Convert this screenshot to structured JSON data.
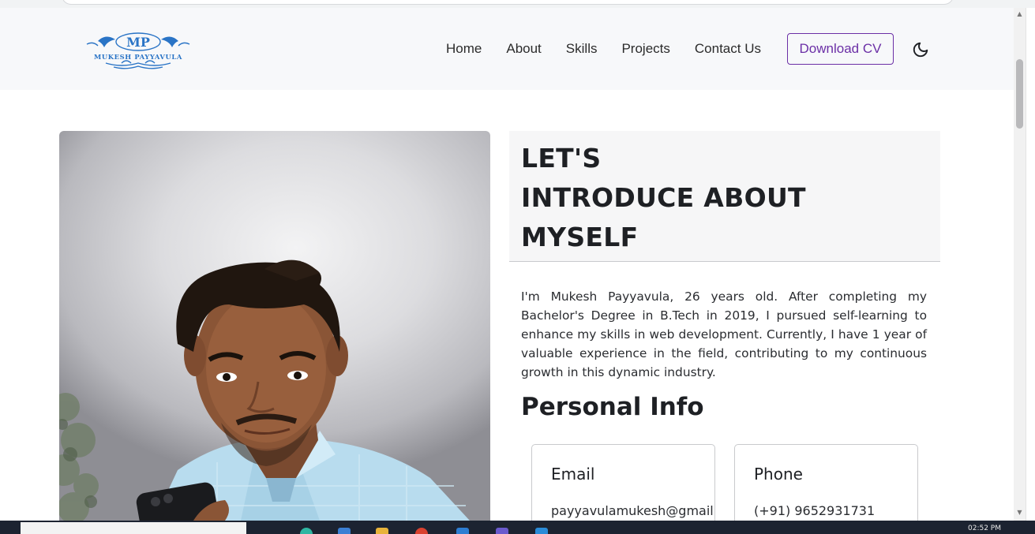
{
  "brand": {
    "initials": "MP",
    "name": "MUKESH PAYYAVULA"
  },
  "nav": {
    "items": [
      "Home",
      "About",
      "Skills",
      "Projects",
      "Contact Us"
    ],
    "cv_button": "Download CV",
    "theme_toggle_icon": "moon-icon"
  },
  "about": {
    "title_lines": [
      "LET'S",
      "INTRODUCE ABOUT",
      "MYSELF"
    ],
    "bio": "I'm Mukesh Payyavula, 26 years old. After completing my Bachelor's Degree in B.Tech in 2019, I pursued self-learning to enhance my skills in web development. Currently, I have 1 year of valuable experience in the field, contributing to my continuous growth in this dynamic industry.",
    "personal_info_title": "Personal Info",
    "cards": [
      {
        "label": "Email",
        "value": "payyavulamukesh@gmail.com"
      },
      {
        "label": "Phone",
        "value": "(+91) 9652931731"
      }
    ]
  },
  "taskbar": {
    "time": "02:52 PM"
  },
  "colors": {
    "accent": "#6b2fa6",
    "logo_blue": "#2a74c6",
    "navbar_bg": "#f7f8fa"
  }
}
